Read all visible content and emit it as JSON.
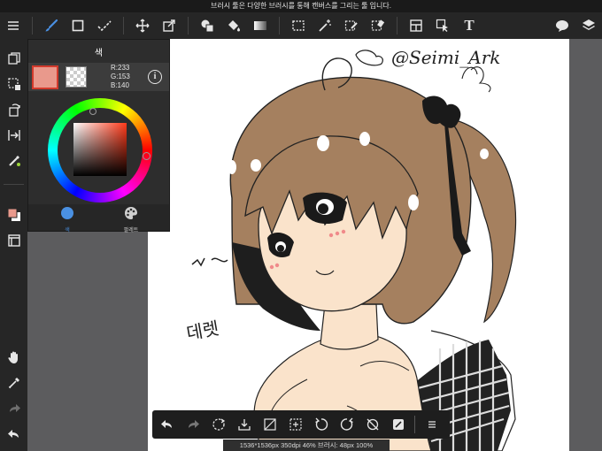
{
  "status_bar": {
    "hint": "브러시 툴은 다양한 브러시를 통해 캔버스를 그리는 툴 입니다."
  },
  "top_toolbar": {
    "items": [
      "menu-icon",
      "brush-icon",
      "rectangle-icon",
      "checkmark-icon",
      "move-icon",
      "transform-icon",
      "fill-shapes-icon",
      "bucket-icon",
      "gradient-icon",
      "select-rect-icon",
      "magic-wand-icon",
      "select-pen-icon",
      "select-eraser-icon",
      "frame-icon",
      "object-select-icon",
      "text-icon",
      "speech-bubble-icon",
      "layers-icon"
    ],
    "text_tool_glyph": "T"
  },
  "left_sidebar": {
    "items": [
      "copy-icon",
      "selection-icon",
      "rotate-icon",
      "flip-icon",
      "eyedropper-color-icon",
      "color-swatch-icon",
      "window-icon",
      "hand-icon",
      "dropper-icon",
      "redo-icon",
      "undo-icon"
    ]
  },
  "color_panel": {
    "title": "색",
    "current_color": "#e9998c",
    "rgb": {
      "r": "R:233",
      "g": "G:153",
      "b": "B:140"
    },
    "info_glyph": "i",
    "tabs": [
      {
        "label": "색",
        "icon": "color-dot-icon",
        "active": true
      },
      {
        "label": "팔레트",
        "icon": "palette-icon",
        "active": false
      }
    ]
  },
  "canvas_text": {
    "signature": "@Seimi_Ark",
    "hangul_note": "데렛"
  },
  "bottom_toolbar": {
    "items": [
      "undo-icon",
      "redo-icon",
      "transform-select-icon",
      "clear-icon",
      "deselect-icon",
      "dotted-select-icon",
      "rotate-left-icon",
      "rotate-right-icon",
      "snap-off-icon",
      "canvas-edit-icon",
      "menu-icon"
    ],
    "canvas_info": "1536*1536px 350dpi 46% 브러시: 48px 100%"
  },
  "colors": {
    "toolbar": "#262626",
    "panel": "#2d2d2d",
    "accent": "#4a90e2",
    "skin": "#fae3cb",
    "hair": "#a5805f"
  }
}
